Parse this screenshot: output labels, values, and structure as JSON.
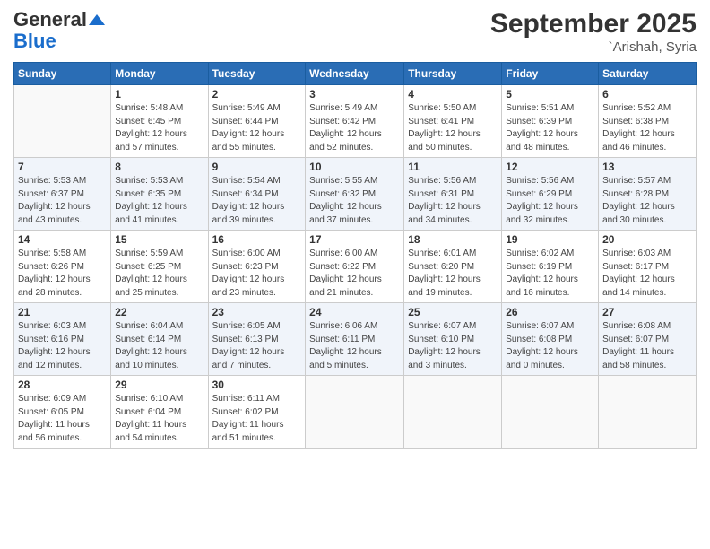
{
  "logo": {
    "general": "General",
    "blue": "Blue"
  },
  "title": "September 2025",
  "subtitle": "`Arishah, Syria",
  "days_of_week": [
    "Sunday",
    "Monday",
    "Tuesday",
    "Wednesday",
    "Thursday",
    "Friday",
    "Saturday"
  ],
  "weeks": [
    [
      {
        "day": "",
        "info": ""
      },
      {
        "day": "1",
        "info": "Sunrise: 5:48 AM\nSunset: 6:45 PM\nDaylight: 12 hours\nand 57 minutes."
      },
      {
        "day": "2",
        "info": "Sunrise: 5:49 AM\nSunset: 6:44 PM\nDaylight: 12 hours\nand 55 minutes."
      },
      {
        "day": "3",
        "info": "Sunrise: 5:49 AM\nSunset: 6:42 PM\nDaylight: 12 hours\nand 52 minutes."
      },
      {
        "day": "4",
        "info": "Sunrise: 5:50 AM\nSunset: 6:41 PM\nDaylight: 12 hours\nand 50 minutes."
      },
      {
        "day": "5",
        "info": "Sunrise: 5:51 AM\nSunset: 6:39 PM\nDaylight: 12 hours\nand 48 minutes."
      },
      {
        "day": "6",
        "info": "Sunrise: 5:52 AM\nSunset: 6:38 PM\nDaylight: 12 hours\nand 46 minutes."
      }
    ],
    [
      {
        "day": "7",
        "info": "Sunrise: 5:53 AM\nSunset: 6:37 PM\nDaylight: 12 hours\nand 43 minutes."
      },
      {
        "day": "8",
        "info": "Sunrise: 5:53 AM\nSunset: 6:35 PM\nDaylight: 12 hours\nand 41 minutes."
      },
      {
        "day": "9",
        "info": "Sunrise: 5:54 AM\nSunset: 6:34 PM\nDaylight: 12 hours\nand 39 minutes."
      },
      {
        "day": "10",
        "info": "Sunrise: 5:55 AM\nSunset: 6:32 PM\nDaylight: 12 hours\nand 37 minutes."
      },
      {
        "day": "11",
        "info": "Sunrise: 5:56 AM\nSunset: 6:31 PM\nDaylight: 12 hours\nand 34 minutes."
      },
      {
        "day": "12",
        "info": "Sunrise: 5:56 AM\nSunset: 6:29 PM\nDaylight: 12 hours\nand 32 minutes."
      },
      {
        "day": "13",
        "info": "Sunrise: 5:57 AM\nSunset: 6:28 PM\nDaylight: 12 hours\nand 30 minutes."
      }
    ],
    [
      {
        "day": "14",
        "info": "Sunrise: 5:58 AM\nSunset: 6:26 PM\nDaylight: 12 hours\nand 28 minutes."
      },
      {
        "day": "15",
        "info": "Sunrise: 5:59 AM\nSunset: 6:25 PM\nDaylight: 12 hours\nand 25 minutes."
      },
      {
        "day": "16",
        "info": "Sunrise: 6:00 AM\nSunset: 6:23 PM\nDaylight: 12 hours\nand 23 minutes."
      },
      {
        "day": "17",
        "info": "Sunrise: 6:00 AM\nSunset: 6:22 PM\nDaylight: 12 hours\nand 21 minutes."
      },
      {
        "day": "18",
        "info": "Sunrise: 6:01 AM\nSunset: 6:20 PM\nDaylight: 12 hours\nand 19 minutes."
      },
      {
        "day": "19",
        "info": "Sunrise: 6:02 AM\nSunset: 6:19 PM\nDaylight: 12 hours\nand 16 minutes."
      },
      {
        "day": "20",
        "info": "Sunrise: 6:03 AM\nSunset: 6:17 PM\nDaylight: 12 hours\nand 14 minutes."
      }
    ],
    [
      {
        "day": "21",
        "info": "Sunrise: 6:03 AM\nSunset: 6:16 PM\nDaylight: 12 hours\nand 12 minutes."
      },
      {
        "day": "22",
        "info": "Sunrise: 6:04 AM\nSunset: 6:14 PM\nDaylight: 12 hours\nand 10 minutes."
      },
      {
        "day": "23",
        "info": "Sunrise: 6:05 AM\nSunset: 6:13 PM\nDaylight: 12 hours\nand 7 minutes."
      },
      {
        "day": "24",
        "info": "Sunrise: 6:06 AM\nSunset: 6:11 PM\nDaylight: 12 hours\nand 5 minutes."
      },
      {
        "day": "25",
        "info": "Sunrise: 6:07 AM\nSunset: 6:10 PM\nDaylight: 12 hours\nand 3 minutes."
      },
      {
        "day": "26",
        "info": "Sunrise: 6:07 AM\nSunset: 6:08 PM\nDaylight: 12 hours\nand 0 minutes."
      },
      {
        "day": "27",
        "info": "Sunrise: 6:08 AM\nSunset: 6:07 PM\nDaylight: 11 hours\nand 58 minutes."
      }
    ],
    [
      {
        "day": "28",
        "info": "Sunrise: 6:09 AM\nSunset: 6:05 PM\nDaylight: 11 hours\nand 56 minutes."
      },
      {
        "day": "29",
        "info": "Sunrise: 6:10 AM\nSunset: 6:04 PM\nDaylight: 11 hours\nand 54 minutes."
      },
      {
        "day": "30",
        "info": "Sunrise: 6:11 AM\nSunset: 6:02 PM\nDaylight: 11 hours\nand 51 minutes."
      },
      {
        "day": "",
        "info": ""
      },
      {
        "day": "",
        "info": ""
      },
      {
        "day": "",
        "info": ""
      },
      {
        "day": "",
        "info": ""
      }
    ]
  ]
}
